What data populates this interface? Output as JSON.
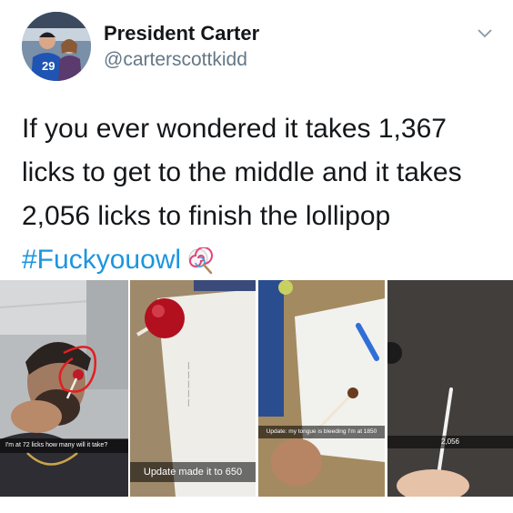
{
  "tweet": {
    "display_name": "President Carter",
    "handle": "@carterscottkidd",
    "text_lines": [
      "If you ever wondered it takes 1,367",
      "licks to get to the middle and it takes",
      "2,056 licks to finish the lollipop"
    ],
    "hashtag": "#Fuckyouowl",
    "avatar_jersey_number": "29"
  },
  "icons": {
    "menu": "chevron-down-icon",
    "emoji": "lollipop-icon"
  },
  "media": {
    "captions": [
      "I'm at 72 licks how many will it take?",
      "Update made it to 650",
      "Update: my tongue is bleeding I'm at 1850",
      "2,056"
    ]
  },
  "colors": {
    "text": "#14171a",
    "secondary": "#657786",
    "link": "#1b95e0"
  }
}
